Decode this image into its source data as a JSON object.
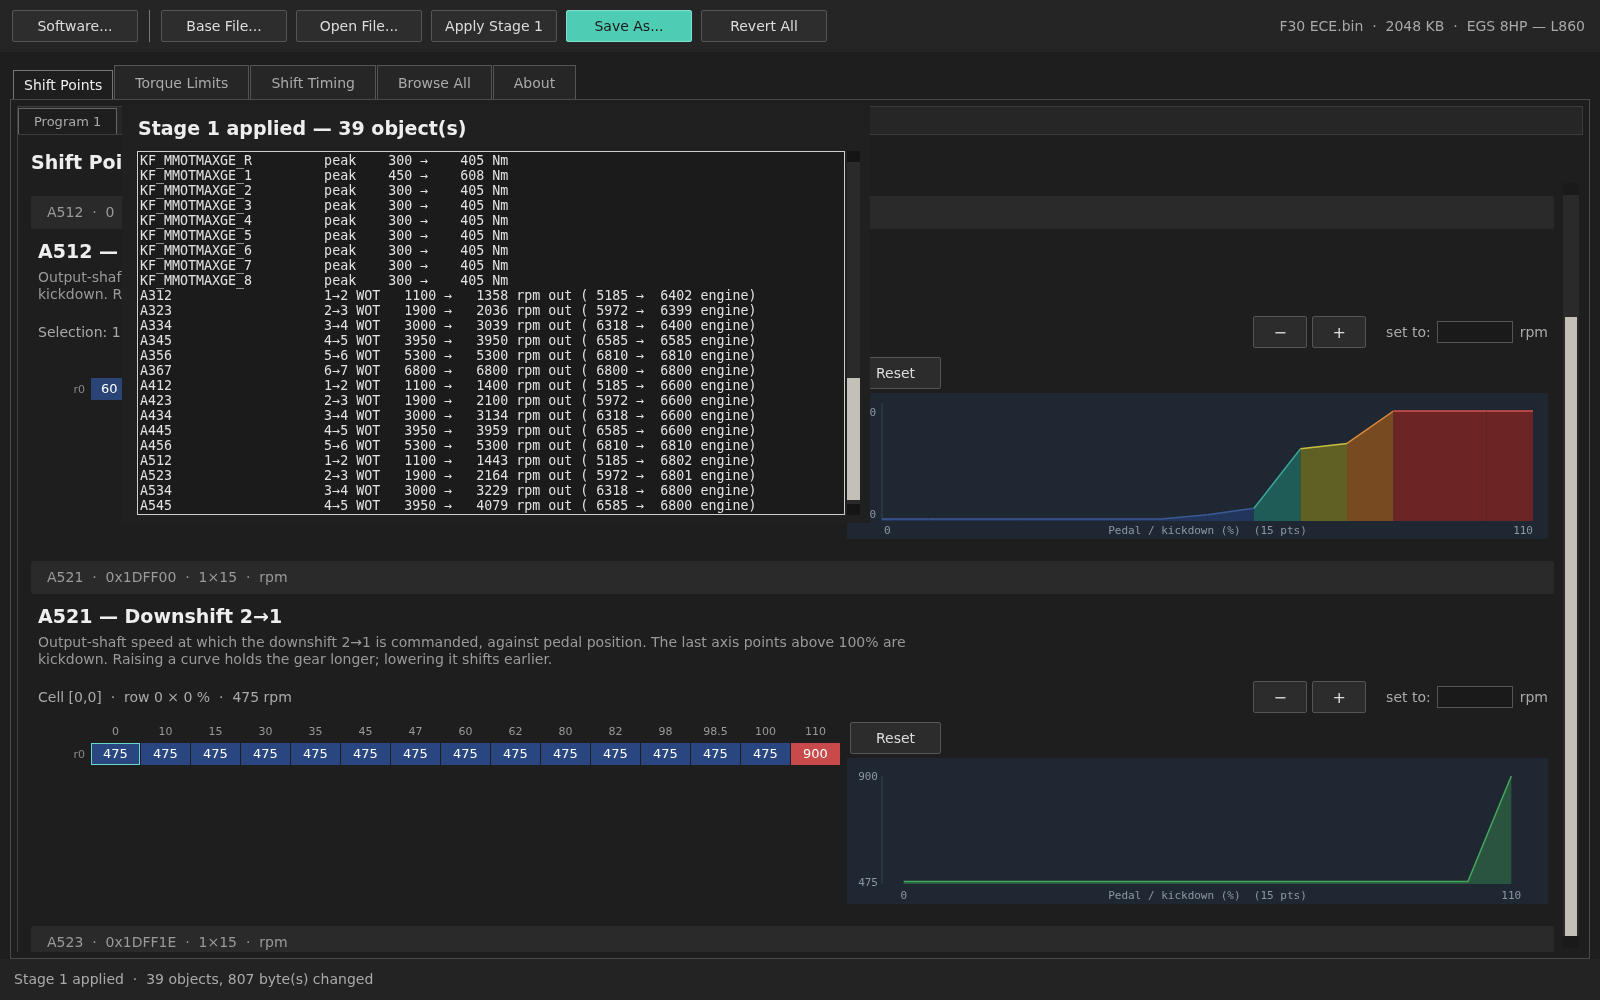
{
  "toolbar": {
    "items": [
      {
        "kind": "plain",
        "label": "Software..."
      },
      {
        "kind": "separator"
      },
      {
        "kind": "plain",
        "label": "Base File..."
      },
      {
        "kind": "plain",
        "label": "Open File..."
      },
      {
        "kind": "plain",
        "label": "Apply Stage 1"
      },
      {
        "kind": "primary",
        "label": "Save As..."
      },
      {
        "kind": "plain",
        "label": "Revert All"
      }
    ],
    "file_info": "F30 ECE.bin  ·  2048 KB  ·  EGS 8HP — L860"
  },
  "tabs": [
    {
      "label": "Shift Points",
      "selected": true
    },
    {
      "label": "Torque Limits",
      "selected": false
    },
    {
      "label": "Shift Timing",
      "selected": false
    },
    {
      "label": "Browse All",
      "selected": false
    },
    {
      "label": "About",
      "selected": false
    }
  ],
  "subtabs": [
    {
      "label": "Program 1",
      "selected": true
    }
  ],
  "page_heading": "Shift Poi",
  "sections": [
    {
      "header": "A512  ·  0",
      "title": "A512 —",
      "description_lines": [
        "Output-shaf",
        "kickdown. R"
      ],
      "status": "Selection: 1",
      "controls": {
        "minus": "−",
        "plus": "+",
        "set_to_label": "set to:",
        "unit": "rpm",
        "reset": "Reset"
      },
      "table": {
        "rows": [
          {
            "label": "r0",
            "cells": [
              {
                "value": "60",
                "color": "#2a4476",
                "selected": false
              }
            ]
          }
        ]
      },
      "chart_picture": {
        "y_labels": [
          "0",
          "0"
        ],
        "x_labels": [
          "0",
          "110"
        ],
        "caption": "Pedal / kickdown (%)  (15 pts)"
      }
    },
    {
      "header": "A521  ·  0x1DFF00  ·  1×15  ·  rpm",
      "title": "A521 — Downshift 2→1",
      "description_lines": [
        "Output-shaft speed at which the downshift 2→1 is commanded, against pedal position. The last axis points above 100% are",
        "kickdown. Raising a curve holds the gear longer; lowering it shifts earlier."
      ],
      "status": "Cell [0,0]  ·  row 0 × 0 %  ·  475 rpm",
      "controls": {
        "minus": "−",
        "plus": "+",
        "set_to_label": "set to:",
        "unit": "rpm",
        "reset": "Reset"
      },
      "table": {
        "columns": [
          "0",
          "10",
          "15",
          "30",
          "35",
          "45",
          "47",
          "60",
          "62",
          "80",
          "82",
          "98",
          "98.5",
          "100",
          "110"
        ],
        "rows": [
          {
            "label": "r0",
            "cells": [
              {
                "value": "475",
                "color": "#2a4680",
                "selected": true
              },
              {
                "value": "475",
                "color": "#2a4680",
                "selected": false
              },
              {
                "value": "475",
                "color": "#2a4680",
                "selected": false
              },
              {
                "value": "475",
                "color": "#2a4680",
                "selected": false
              },
              {
                "value": "475",
                "color": "#2a4680",
                "selected": false
              },
              {
                "value": "475",
                "color": "#2a4680",
                "selected": false
              },
              {
                "value": "475",
                "color": "#2a4680",
                "selected": false
              },
              {
                "value": "475",
                "color": "#2a4680",
                "selected": false
              },
              {
                "value": "475",
                "color": "#2a4680",
                "selected": false
              },
              {
                "value": "475",
                "color": "#2a4680",
                "selected": false
              },
              {
                "value": "475",
                "color": "#2a4680",
                "selected": false
              },
              {
                "value": "475",
                "color": "#2a4680",
                "selected": false
              },
              {
                "value": "475",
                "color": "#2a4680",
                "selected": false
              },
              {
                "value": "475",
                "color": "#2a4680",
                "selected": false
              },
              {
                "value": "900",
                "color": "#c94a4a",
                "selected": false
              }
            ]
          }
        ]
      },
      "chart_data": {
        "type": "area",
        "xlabel": "Pedal / kickdown (%)  (15 pts)",
        "categories": [
          "0",
          null,
          null,
          null,
          null,
          null,
          null,
          null,
          null,
          null,
          null,
          null,
          null,
          null,
          "110"
        ],
        "series": [
          {
            "color": "#43a85a",
            "values": [
              475,
              475,
              475,
              475,
              475,
              475,
              475,
              475,
              475,
              475,
              475,
              475,
              475,
              475,
              900
            ]
          }
        ],
        "ylim": [
          465,
          900
        ],
        "yticks": [
          475,
          900
        ]
      }
    },
    {
      "header": "A523  ·  0x1DFF1E  ·  1×15  ·  rpm"
    }
  ],
  "dialog": {
    "title": "Stage 1 applied — 39 object(s)",
    "lines": [
      "KF_MMOTMAXGE_R         peak    300 →    405 Nm",
      "KF_MMOTMAXGE_1         peak    450 →    608 Nm",
      "KF_MMOTMAXGE_2         peak    300 →    405 Nm",
      "KF_MMOTMAXGE_3         peak    300 →    405 Nm",
      "KF_MMOTMAXGE_4         peak    300 →    405 Nm",
      "KF_MMOTMAXGE_5         peak    300 →    405 Nm",
      "KF_MMOTMAXGE_6         peak    300 →    405 Nm",
      "KF_MMOTMAXGE_7         peak    300 →    405 Nm",
      "KF_MMOTMAXGE_8         peak    300 →    405 Nm",
      "A312                   1→2 WOT   1100 →   1358 rpm out ( 5185 →  6402 engine)",
      "A323                   2→3 WOT   1900 →   2036 rpm out ( 5972 →  6399 engine)",
      "A334                   3→4 WOT   3000 →   3039 rpm out ( 6318 →  6400 engine)",
      "A345                   4→5 WOT   3950 →   3950 rpm out ( 6585 →  6585 engine)",
      "A356                   5→6 WOT   5300 →   5300 rpm out ( 6810 →  6810 engine)",
      "A367                   6→7 WOT   6800 →   6800 rpm out ( 6800 →  6800 engine)",
      "A412                   1→2 WOT   1100 →   1400 rpm out ( 5185 →  6600 engine)",
      "A423                   2→3 WOT   1900 →   2100 rpm out ( 5972 →  6600 engine)",
      "A434                   3→4 WOT   3000 →   3134 rpm out ( 6318 →  6600 engine)",
      "A445                   4→5 WOT   3950 →   3959 rpm out ( 6585 →  6600 engine)",
      "A456                   5→6 WOT   5300 →   5300 rpm out ( 6810 →  6810 engine)",
      "A512                   1→2 WOT   1100 →   1443 rpm out ( 5185 →  6802 engine)",
      "A523                   2→3 WOT   1900 →   2164 rpm out ( 5972 →  6801 engine)",
      "A534                   3→4 WOT   3000 →   3229 rpm out ( 6318 →  6800 engine)",
      "A545                   4→5 WOT   3950 →   4079 rpm out ( 6585 →  6800 engine)"
    ]
  },
  "status_bar": "Stage 1 applied  ·  39 objects, 807 byte(s) changed"
}
